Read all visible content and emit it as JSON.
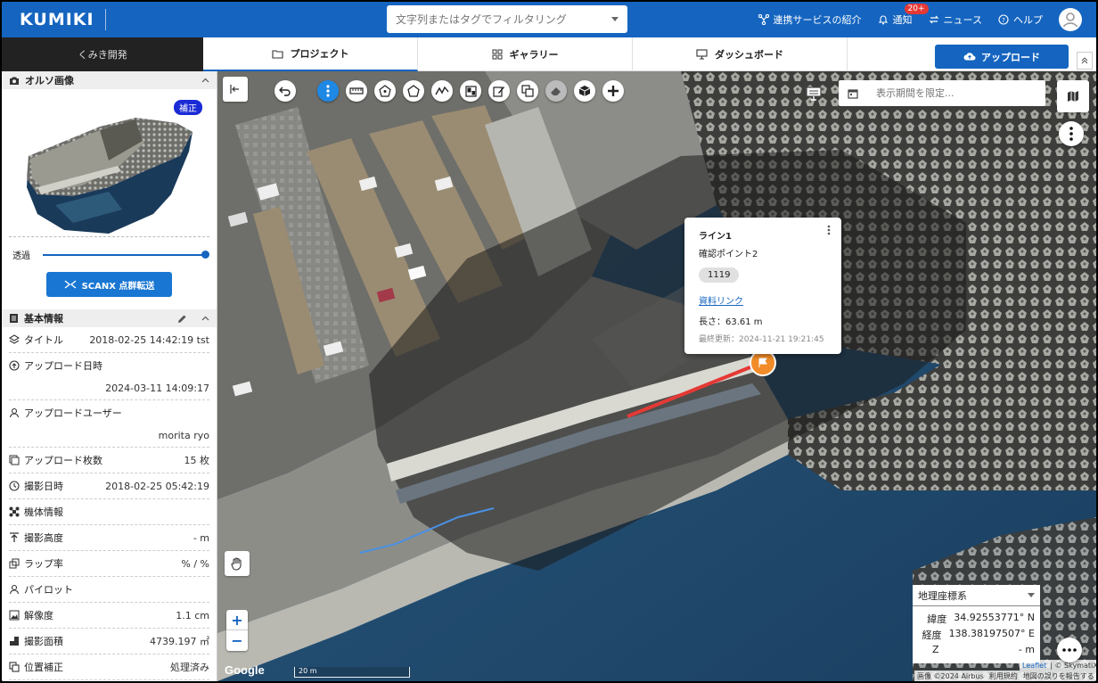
{
  "app": {
    "logo": "KUMIKI"
  },
  "header": {
    "search_placeholder": "文字列またはタグでフィルタリング",
    "services": "連携サービスの紹介",
    "notifications": "通知",
    "notifications_badge": "20+",
    "news": "ニュース",
    "help": "ヘルプ"
  },
  "nav": {
    "breadcrumb": "くみき開発",
    "tabs": [
      {
        "label": "プロジェクト",
        "icon": "folder-icon"
      },
      {
        "label": "ギャラリー",
        "icon": "grid-icon"
      },
      {
        "label": "ダッシュボード",
        "icon": "monitor-icon"
      }
    ],
    "upload_label": "アップロード"
  },
  "sidebar": {
    "ortho_title": "オルソ画像",
    "ortho_badge": "補正",
    "opacity_label": "透過",
    "opacity_value": 1.0,
    "scanx_label": "SCANX 点群転送",
    "info_title": "基本情報",
    "rows": [
      {
        "label": "タイトル",
        "value": "2018-02-25 14:42:19 tst",
        "icon": "layers-icon"
      },
      {
        "label": "アップロード日時",
        "value": "2024-03-11 14:09:17",
        "icon": "cloud-upload-icon"
      },
      {
        "label": "アップロードユーザー",
        "value": "morita ryo",
        "icon": "person-icon"
      },
      {
        "label": "アップロード枚数",
        "value": "15 枚",
        "icon": "images-icon"
      },
      {
        "label": "撮影日時",
        "value": "2018-02-25 05:42:19",
        "icon": "clock-icon"
      },
      {
        "label": "機体情報",
        "value": "",
        "icon": "drone-icon"
      },
      {
        "label": "撮影高度",
        "value": "- m",
        "icon": "altitude-icon"
      },
      {
        "label": "ラップ率",
        "value": "% / %",
        "icon": "overlap-icon"
      },
      {
        "label": "パイロット",
        "value": "",
        "icon": "person-icon"
      },
      {
        "label": "解像度",
        "value": "1.1 cm",
        "icon": "image-icon"
      },
      {
        "label": "撮影面積",
        "value": "4739.197 ㎡",
        "icon": "area-icon"
      },
      {
        "label": "位置補正",
        "value": "処理済み",
        "icon": "copy-icon"
      }
    ]
  },
  "map": {
    "date_filter_placeholder": "表示期間を限定...",
    "popup": {
      "title": "ライン1",
      "subtitle": "確認ポイント2",
      "chip": "1119",
      "link": "資料リンク",
      "length": "長さ：63.61 m",
      "updated": "最終更新：2024-11-21 19:21:45"
    },
    "coord": {
      "system": "地理座標系",
      "lat_label": "緯度",
      "lat_value": "34.92553771° N",
      "lon_label": "経度",
      "lon_value": "138.38197507° E",
      "z_label": "Z",
      "z_value": "- m"
    },
    "zoom_in": "+",
    "zoom_out": "−",
    "google": "Google",
    "scale": "20 m",
    "attribution": [
      "画像 ©2024 Airbus",
      "利用規約",
      "地図の誤りを報告する"
    ],
    "leaflet": [
      "Leaflet",
      "| © SkymatiX"
    ]
  }
}
